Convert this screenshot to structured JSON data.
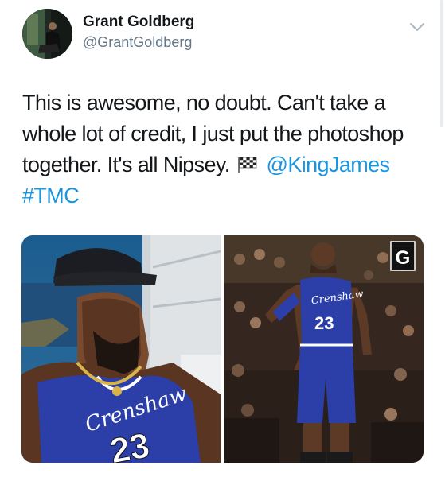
{
  "tweet": {
    "author_name": "Grant Goldberg",
    "author_handle": "@GrantGoldberg",
    "text_part1": "This is awesome, no doubt. Can't take a whole lot of credit, I just put the photoshop together. It's all Nipsey.",
    "flag_icon": "checkered-flag-emoji",
    "mention": "@KingJames",
    "hashtag": "#TMC"
  },
  "media": {
    "left_photo": {
      "jersey_script": "Crenshaw",
      "jersey_number": "23"
    },
    "right_photo": {
      "jersey_script": "Crenshaw",
      "jersey_number": "23",
      "watermark_letter": "G"
    }
  },
  "colors": {
    "link": "#1b95e0",
    "secondary_text": "#657786",
    "jersey_blue": "#2c3ea8"
  }
}
